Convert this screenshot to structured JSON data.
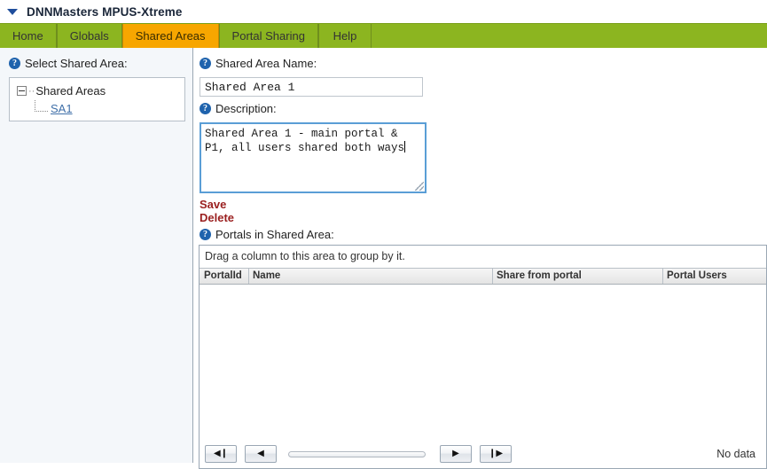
{
  "window": {
    "title": "DNNMasters MPUS-Xtreme",
    "collapse_icon": "triangle-down-icon"
  },
  "tabs": [
    {
      "label": "Home",
      "active": false
    },
    {
      "label": "Globals",
      "active": false
    },
    {
      "label": "Shared Areas",
      "active": true
    },
    {
      "label": "Portal Sharing",
      "active": false
    },
    {
      "label": "Help",
      "active": false
    }
  ],
  "left": {
    "select_label": "Select Shared Area:",
    "tree": {
      "root": "Shared Areas",
      "children": [
        "SA1"
      ]
    }
  },
  "form": {
    "name_label": "Shared Area Name:",
    "name_value": "Shared Area 1",
    "name_placeholder": "",
    "description_label": "Description:",
    "description_value": "Shared Area 1 - main portal & P1, all users shared both ways",
    "description_placeholder": "",
    "save_label": "Save",
    "delete_label": "Delete"
  },
  "grid": {
    "title_label": "Portals in Shared Area:",
    "group_panel_text": "Drag a column to this area to group by it.",
    "columns": [
      "PortalId",
      "Name",
      "Share from portal",
      "Portal Users"
    ],
    "rows": [],
    "empty_text": "No data",
    "pager": {
      "first_glyph": "◀❙",
      "prev_glyph": "◀",
      "next_glyph": "▶",
      "last_glyph": "❙▶",
      "first_name": "first-page-icon",
      "prev_name": "previous-page-icon",
      "next_name": "next-page-icon",
      "last_name": "last-page-icon"
    }
  },
  "icons": {
    "help": "?"
  },
  "colors": {
    "tab_bar_green": "#8cb520",
    "tab_active_orange": "#f7a600",
    "action_link_red": "#9a1f1f",
    "help_icon_blue": "#1f63ad",
    "focus_border_blue": "#5a9ed6"
  }
}
